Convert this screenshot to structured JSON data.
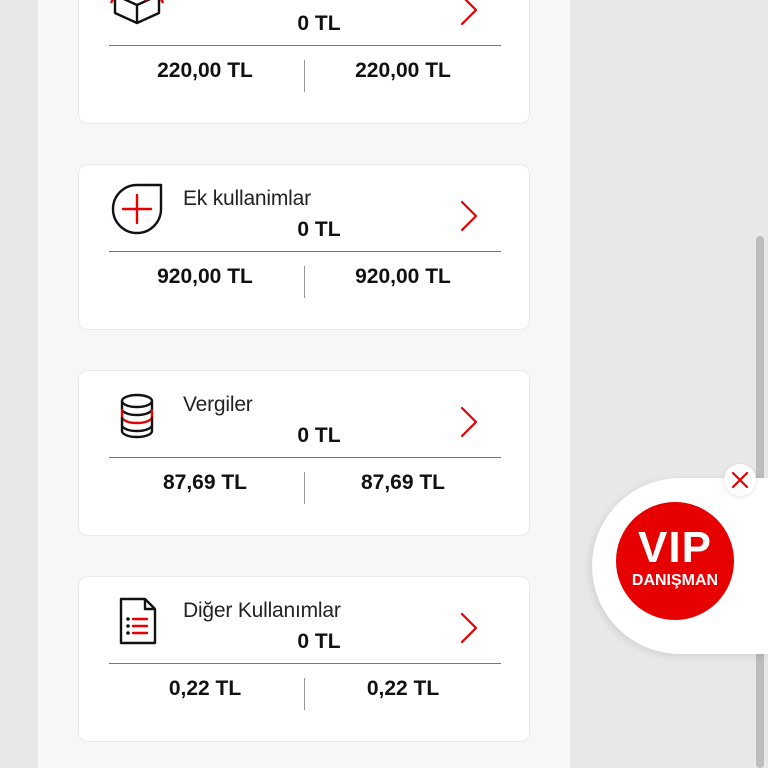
{
  "colors": {
    "accent": "#e60000",
    "text": "#111111",
    "card_bg": "#ffffff",
    "page_bg": "#e8e8e8"
  },
  "cards": [
    {
      "icon": "package-icon",
      "title": "",
      "amount": "0 TL",
      "left_value": "220,00 TL",
      "right_value": "220,00 TL"
    },
    {
      "icon": "add-usage-icon",
      "title": "Ek kullanimlar",
      "amount": "0 TL",
      "left_value": "920,00 TL",
      "right_value": "920,00 TL"
    },
    {
      "icon": "coins-icon",
      "title": "Vergiler",
      "amount": "0 TL",
      "left_value": "87,69 TL",
      "right_value": "87,69 TL"
    },
    {
      "icon": "document-list-icon",
      "title": "Diğer Kullanımlar",
      "amount": "0 TL",
      "left_value": "0,22 TL",
      "right_value": "0,22 TL"
    }
  ],
  "vip": {
    "title": "VIP",
    "subtitle": "DANIŞMAN",
    "close_icon": "close-icon"
  }
}
